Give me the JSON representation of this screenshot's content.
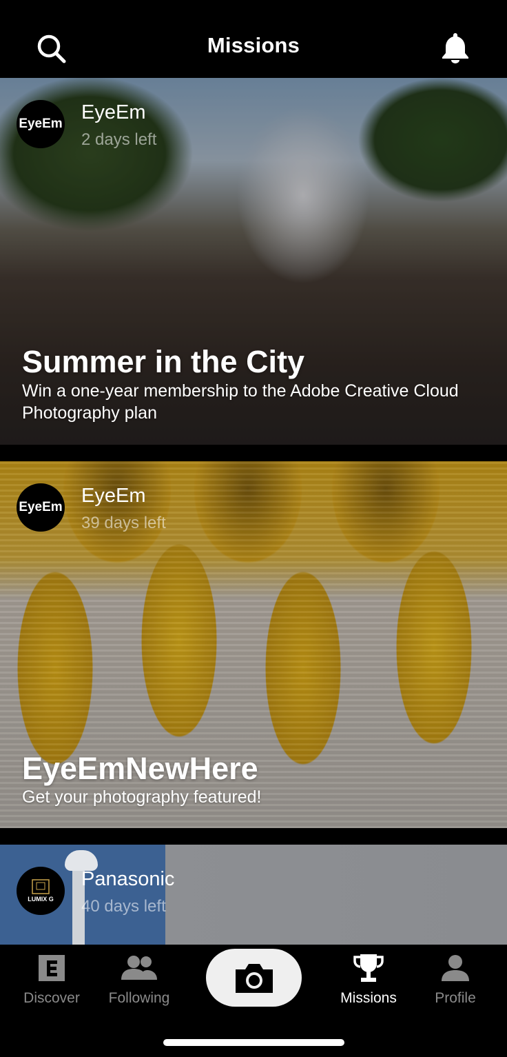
{
  "header": {
    "title": "Missions"
  },
  "missions": [
    {
      "sponsor": "EyeEm",
      "avatar_text": "EyeEm",
      "days_left": "2 days left",
      "title": "Summer in the City",
      "description": "Win a one-year membership to the Adobe Creative Cloud Photography plan"
    },
    {
      "sponsor": "EyeEm",
      "avatar_text": "EyeEm",
      "days_left": "39 days left",
      "title": "EyeEmNewHere",
      "description": "Get your photography featured!"
    },
    {
      "sponsor": "Panasonic",
      "avatar_text": "LUMIX G",
      "days_left": "40 days left"
    }
  ],
  "tabbar": {
    "items": [
      {
        "label": "Discover",
        "icon": "discover-icon"
      },
      {
        "label": "Following",
        "icon": "following-icon"
      },
      {
        "label": "",
        "icon": "camera-icon"
      },
      {
        "label": "Missions",
        "icon": "trophy-icon",
        "active": true
      },
      {
        "label": "Profile",
        "icon": "profile-icon"
      }
    ]
  },
  "colors": {
    "background": "#000000",
    "active_tab": "#ffffff",
    "inactive_tab": "#8a8a8a",
    "camera_button": "#efefef"
  }
}
